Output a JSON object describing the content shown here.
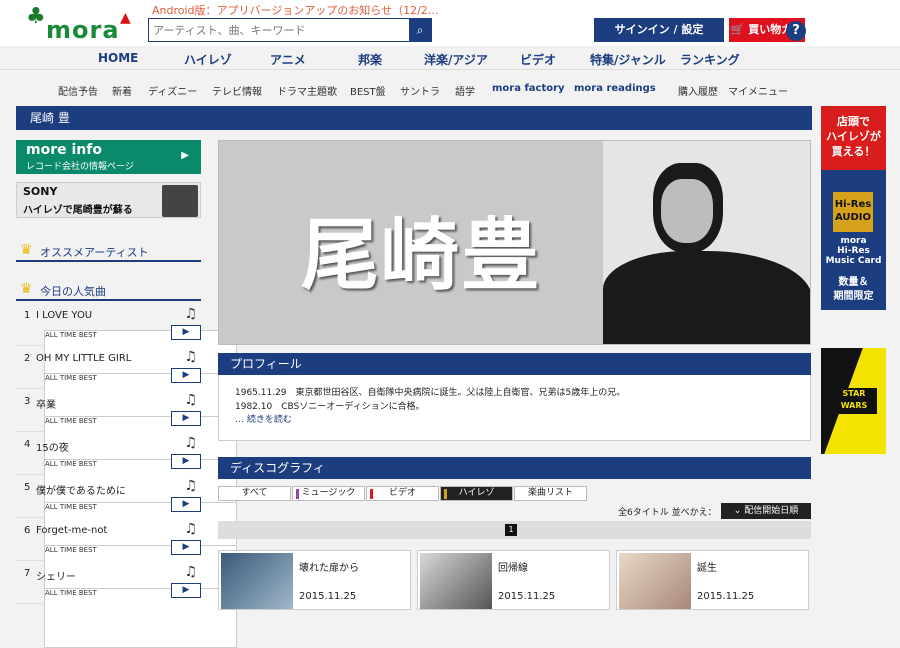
{
  "header": {
    "notice": "Android版：アプリバージョンアップのお知らせ（12/2…",
    "search_placeholder": "アーティスト、曲、キーワード",
    "signin_label": "サインイン / 設定",
    "cart_label": "買い物カゴ",
    "help_label": "?",
    "logo_text": "mora"
  },
  "main_nav": [
    "HOME",
    "ハイレゾ",
    "アニメ",
    "邦楽",
    "洋楽/アジア",
    "ビデオ",
    "特集/ジャンル",
    "ランキング"
  ],
  "sub_nav": [
    "配信予告",
    "新着",
    "ディズニー",
    "テレビ情報",
    "ドラマ主題歌",
    "BEST盤",
    "サントラ",
    "語学",
    "mora factory",
    "mora readings",
    "購入履歴",
    "マイメニュー"
  ],
  "page_title": "尾崎 豊",
  "more_info": {
    "title": "more info",
    "subtitle": "レコード会社の情報ページ",
    "arrow": "▶"
  },
  "sony_banner": {
    "brand": "SONY",
    "copy": "ハイレゾで尾崎豊が蘇る"
  },
  "recommend_title": "オススメアーティスト",
  "popular_title": "今日の人気曲",
  "tracks": [
    {
      "num": "1",
      "name": "I LOVE YOU",
      "album": "ALL TIME BEST"
    },
    {
      "num": "2",
      "name": "OH MY LITTLE GIRL",
      "album": "ALL TIME BEST"
    },
    {
      "num": "3",
      "name": "卒業",
      "album": "ALL TIME BEST"
    },
    {
      "num": "4",
      "name": "15の夜",
      "album": "ALL TIME BEST"
    },
    {
      "num": "5",
      "name": "僕が僕であるために",
      "album": "ALL TIME BEST"
    },
    {
      "num": "6",
      "name": "Forget-me-not",
      "album": "ALL TIME BEST"
    },
    {
      "num": "7",
      "name": "シェリー",
      "album": "ALL TIME BEST"
    }
  ],
  "hero": {
    "name": "尾崎豊"
  },
  "profile": {
    "title": "プロフィール",
    "line1": "1965.11.29　東京都世田谷区、自衛隊中央病院に誕生。父は陸上自衛官、兄弟は5歳年上の兄。",
    "line2": "1982.10　CBSソニーオーディションに合格。",
    "more": "… 続きを読む"
  },
  "discography": {
    "title": "ディスコグラフィ",
    "tabs": [
      "すべて",
      "ミュージック",
      "ビデオ",
      "ハイレゾ",
      "楽曲リスト"
    ],
    "tab_colors": [
      "",
      "#8e44ad",
      "#d91c1c",
      "#d7a21b",
      ""
    ],
    "active_tab": "ハイレゾ",
    "sort_text": "全6タイトル 並べかえ：",
    "sort_button": "⌄ 配信開始日順",
    "page": "1",
    "albums": [
      {
        "name": "壊れた扉から",
        "date": "2015.11.25"
      },
      {
        "name": "回帰線",
        "date": "2015.11.25"
      },
      {
        "name": "誕生",
        "date": "2015.11.25"
      }
    ]
  },
  "right_banner": {
    "top": "店頭で\nハイレゾが\n買える！",
    "hires": "Hi-Res\nAUDIO",
    "mora": "mora\nHi-Res\nMusic Card",
    "limit": "数量＆\n期間限定"
  },
  "starwars": "STAR\nWARS",
  "colors": {
    "navy": "#1c3d80",
    "green": "#0a8a6a",
    "red": "#e0111f",
    "gold": "#e8b90f"
  }
}
